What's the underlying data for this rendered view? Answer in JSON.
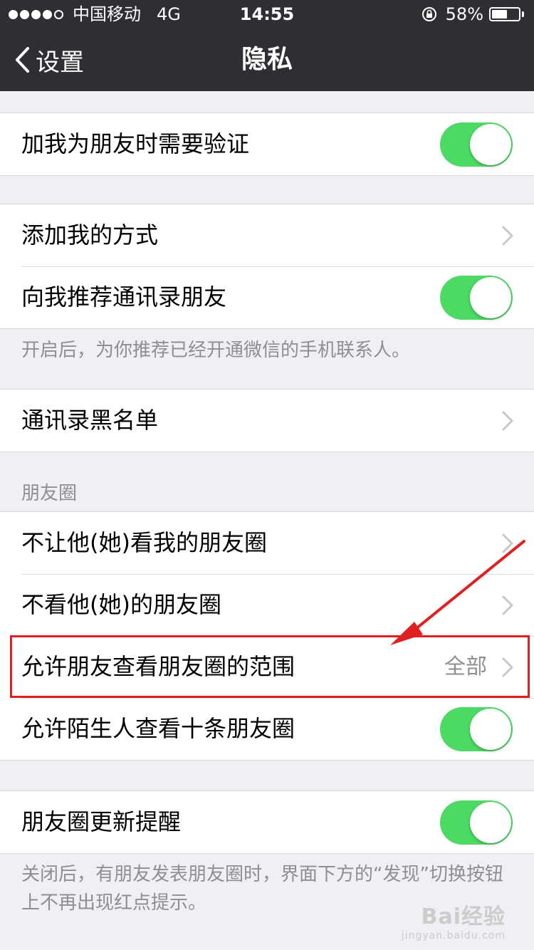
{
  "status_bar": {
    "carrier": "中国移动",
    "network": "4G",
    "time": "14:55",
    "battery": "58%",
    "battery_level": 0.58,
    "signal_bars_filled": 4,
    "signal_bars_total": 5
  },
  "nav": {
    "back_label": "设置",
    "title": "隐私"
  },
  "groups": {
    "verify": {
      "label": "加我为朋友时需要验证",
      "on": true
    },
    "add_methods": {
      "label": "添加我的方式"
    },
    "recommend_contacts": {
      "label": "向我推荐通讯录朋友",
      "on": true
    },
    "recommend_note": "开启后，为你推荐已经开通微信的手机联系人。",
    "blacklist": {
      "label": "通讯录黑名单"
    },
    "moments_header": "朋友圈",
    "moments_block": {
      "label": "不让他(她)看我的朋友圈"
    },
    "moments_hide": {
      "label": "不看他(她)的朋友圈"
    },
    "moments_range": {
      "label": "允许朋友查看朋友圈的范围",
      "value": "全部"
    },
    "moments_strangers": {
      "label": "允许陌生人查看十条朋友圈",
      "on": true
    },
    "moments_update": {
      "label": "朋友圈更新提醒",
      "on": true
    },
    "update_note": "关闭后，有朋友发表朋友圈时，界面下方的“发现”切换按钮上不再出现红点提示。"
  },
  "watermark": {
    "main": "Bai经验",
    "sub": "jingyan.baidu.com"
  },
  "colors": {
    "navbar_bg": "#2e2e33",
    "page_bg": "#efeff4",
    "toggle_on": "#4cd964",
    "annotation_red": "#e02020"
  },
  "icons": [
    "back-chevron-icon",
    "lock-rotation-icon",
    "battery-icon",
    "chevron-right-icon"
  ]
}
